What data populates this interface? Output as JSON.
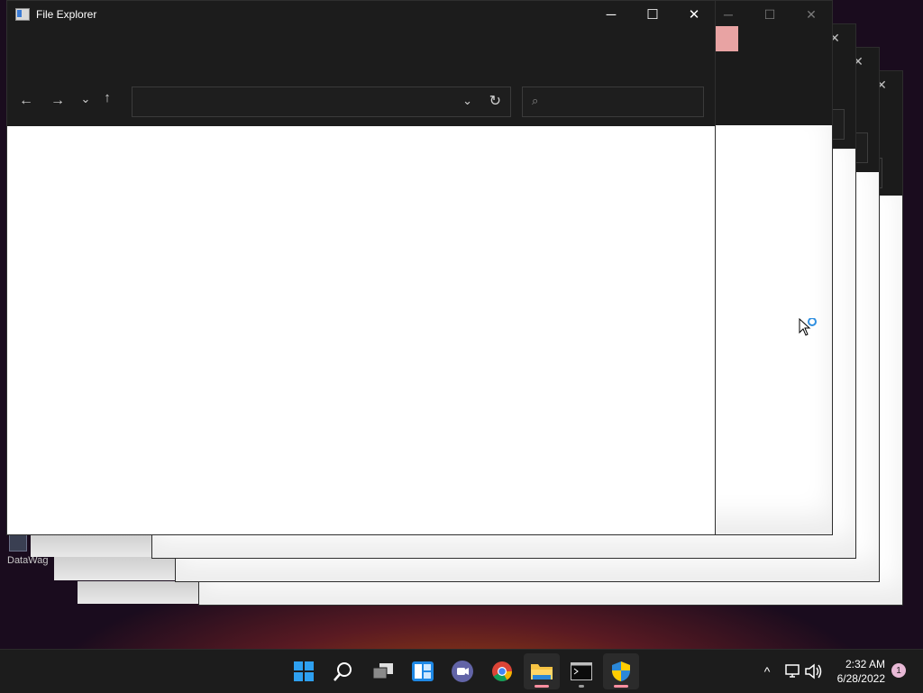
{
  "window": {
    "title": "File Explorer",
    "minimize_glyph": "─",
    "maximize_glyph": "☐",
    "close_glyph": "✕"
  },
  "toolbar": {
    "back_glyph": "←",
    "forward_glyph": "→",
    "recent_glyph": "⌄",
    "up_glyph": "↑",
    "address_value": "",
    "address_dropdown_glyph": "⌄",
    "refresh_glyph": "↻",
    "search_placeholder": "",
    "search_glyph": "⌕"
  },
  "desktop": {
    "icon_label": "DataWag"
  },
  "taskbar": {
    "apps": [
      {
        "name": "start-icon"
      },
      {
        "name": "search-icon"
      },
      {
        "name": "task-view-icon"
      },
      {
        "name": "widgets-icon"
      },
      {
        "name": "teams-chat-icon"
      },
      {
        "name": "chrome-icon"
      },
      {
        "name": "file-explorer-icon"
      },
      {
        "name": "terminal-icon"
      },
      {
        "name": "security-shield-icon"
      }
    ],
    "tray": {
      "chevron": "^",
      "time": "2:32 AM",
      "date": "6/28/2022",
      "notification_count": "1"
    }
  },
  "colors": {
    "accent": "#0078d4",
    "indicator_active": "#ff8fa0"
  }
}
